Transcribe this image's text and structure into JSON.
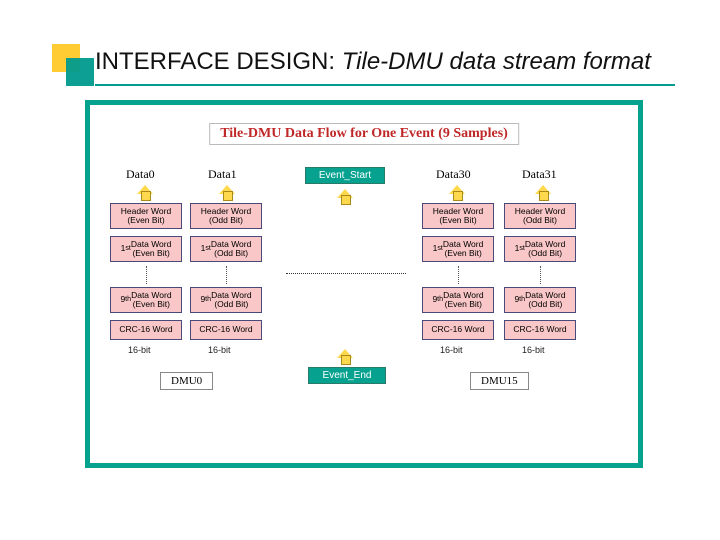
{
  "title": {
    "strong": "INTERFACE DESIGN:",
    "em": "Tile-DMU data stream format"
  },
  "flow_title": "Tile-DMU Data Flow for One Event (9 Samples)",
  "columns": {
    "c0": "Data0",
    "c1": "Data1",
    "c30": "Data30",
    "c31": "Data31"
  },
  "event": {
    "start": "Event_Start",
    "end": "Event_End"
  },
  "boxes": {
    "header_even": "Header Word\n(Even Bit)",
    "header_odd": "Header Word\n(Odd Bit)",
    "first_even": "1st Data Word\n(Even Bit)",
    "first_odd": "1st Data Word\n(Odd Bit)",
    "ninth_even": "9th Data Word\n(Even Bit)",
    "ninth_odd": "9th Data Word\n(Odd Bit)",
    "crc": "CRC-16 Word"
  },
  "bits": "16-bit",
  "dmu": {
    "left": "DMU0",
    "right": "DMU15"
  }
}
